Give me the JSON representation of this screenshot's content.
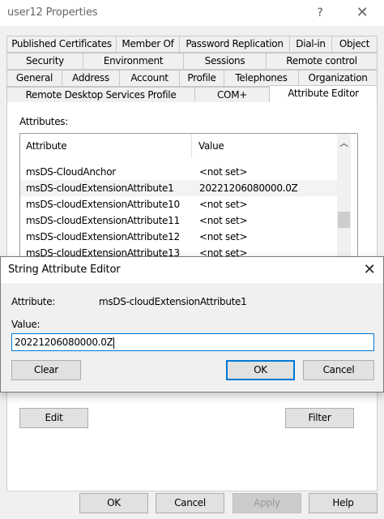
{
  "window": {
    "title": "user12 Properties",
    "help_glyph": "?",
    "close_glyph": "✕"
  },
  "tabs": {
    "row1": [
      "Published Certificates",
      "Member Of",
      "Password Replication",
      "Dial-in",
      "Object"
    ],
    "row2": [
      "Security",
      "Environment",
      "Sessions",
      "Remote control"
    ],
    "row3": [
      "General",
      "Address",
      "Account",
      "Profile",
      "Telephones",
      "Organization"
    ],
    "row4": [
      "Remote Desktop Services Profile",
      "COM+",
      "Attribute Editor"
    ],
    "active": "Attribute Editor"
  },
  "attributes": {
    "label": "Attributes:",
    "col_attribute": "Attribute",
    "col_value": "Value",
    "rows": [
      {
        "name": "msDS-CloudAnchor",
        "value": "<not set>"
      },
      {
        "name": "msDS-cloudExtensionAttribute1",
        "value": "20221206080000.0Z"
      },
      {
        "name": "msDS-cloudExtensionAttribute10",
        "value": "<not set>"
      },
      {
        "name": "msDS-cloudExtensionAttribute11",
        "value": "<not set>"
      },
      {
        "name": "msDS-cloudExtensionAttribute12",
        "value": "<not set>"
      },
      {
        "name": "msDS-cloudExtensionAttribute13",
        "value": "<not set>"
      }
    ],
    "scroll_up_glyph": "︿"
  },
  "panel_buttons": {
    "edit": "Edit",
    "filter": "Filter"
  },
  "bottom_buttons": {
    "ok": "OK",
    "cancel": "Cancel",
    "apply": "Apply",
    "help": "Help"
  },
  "dialog": {
    "title": "String Attribute Editor",
    "close_glyph": "✕",
    "attribute_label": "Attribute:",
    "attribute_value": "msDS-cloudExtensionAttribute1",
    "value_label": "Value:",
    "value_text": "20221206080000.0Z",
    "clear": "Clear",
    "ok": "OK",
    "cancel": "Cancel"
  }
}
